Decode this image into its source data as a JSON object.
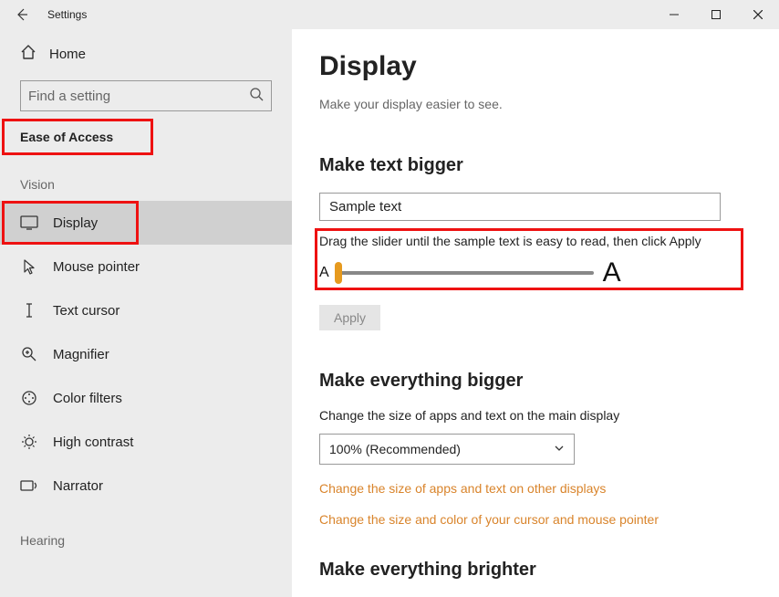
{
  "titlebar": {
    "title": "Settings"
  },
  "sidebar": {
    "home": "Home",
    "search_placeholder": "Find a setting",
    "category": "Ease of Access",
    "groups": [
      {
        "heading": "Vision",
        "items": [
          {
            "label": "Display"
          },
          {
            "label": "Mouse pointer"
          },
          {
            "label": "Text cursor"
          },
          {
            "label": "Magnifier"
          },
          {
            "label": "Color filters"
          },
          {
            "label": "High contrast"
          },
          {
            "label": "Narrator"
          }
        ]
      },
      {
        "heading": "Hearing",
        "items": []
      }
    ]
  },
  "main": {
    "title": "Display",
    "subtitle": "Make your display easier to see.",
    "text_bigger": {
      "heading": "Make text bigger",
      "sample": "Sample text",
      "help": "Drag the slider until the sample text is easy to read, then click Apply",
      "apply": "Apply"
    },
    "everything_bigger": {
      "heading": "Make everything bigger",
      "body": "Change the size of apps and text on the main display",
      "select_value": "100% (Recommended)",
      "link1": "Change the size of apps and text on other displays",
      "link2": "Change the size and color of your cursor and mouse pointer"
    },
    "brighter": {
      "heading": "Make everything brighter"
    }
  }
}
